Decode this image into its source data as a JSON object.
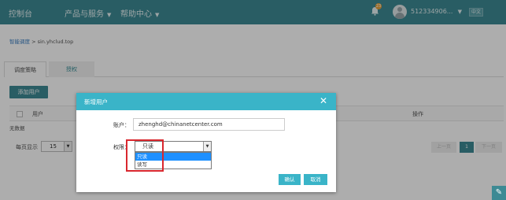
{
  "topnav": {
    "console": "控制台",
    "products": "产品与服务",
    "help": "帮助中心",
    "notification_count": "23",
    "user_id": "512334906...",
    "language": "中文"
  },
  "breadcrumb": {
    "link": "智能调度",
    "separator": " > ",
    "current": "sin.yhclud.top"
  },
  "tabs": [
    "调度策略",
    "授权"
  ],
  "add_user_button": "添加用户",
  "table": {
    "columns": [
      "用户",
      "操作"
    ],
    "empty_text": "无数据"
  },
  "pagination": {
    "page_size_label": "每页显示",
    "page_size": "15",
    "prev": "上一页",
    "current_page": "1",
    "next": "下一页"
  },
  "modal": {
    "title": "新增用户",
    "close": "✕",
    "account_label": "账户：",
    "account_value": "zhenghd@chinanetcenter.com",
    "permission_label": "权限：",
    "permission_selected": "只读",
    "permission_options": [
      "只读",
      "读写"
    ],
    "confirm": "确认",
    "cancel": "取消"
  },
  "colors": {
    "nav": "#3d8a94",
    "modal_header": "#3ab4c8",
    "selected_option": "#1e90ff",
    "highlight": "#d9272e"
  }
}
